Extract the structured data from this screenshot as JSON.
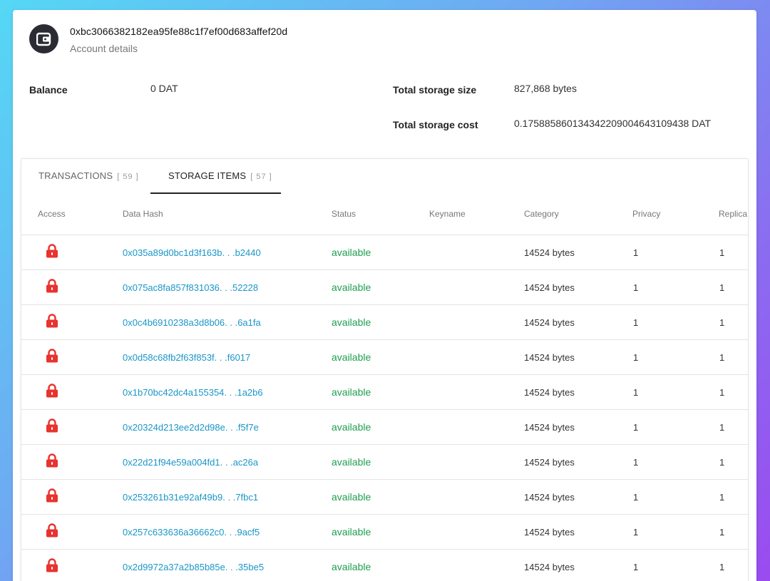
{
  "account": {
    "address": "0xbc3066382182ea95fe88c1f7ef00d683affef20d",
    "subtitle": "Account details",
    "icon": "wallet-icon"
  },
  "summary": {
    "balance_label": "Balance",
    "balance_value": "0 DAT",
    "storage_size_label": "Total storage size",
    "storage_size_value": "827,868 bytes",
    "storage_cost_label": "Total storage cost",
    "storage_cost_value": "0.1758858601343422090046431094 38 DAT"
  },
  "tabs": [
    {
      "label": "TRANSACTIONS",
      "count": "[ 59 ]",
      "active": false
    },
    {
      "label": "STORAGE ITEMS",
      "count": "[ 57 ]",
      "active": true
    }
  ],
  "table": {
    "columns": [
      "Access",
      "Data Hash",
      "Status",
      "Keyname",
      "Category",
      "Privacy",
      "Replica"
    ],
    "rows": [
      {
        "access": "lock-icon",
        "hash": "0x035a89d0bc1d3f163b. . .b2440",
        "status": "available",
        "keyname": "",
        "category": "14524 bytes",
        "privacy": "1",
        "replica": "1"
      },
      {
        "access": "lock-icon",
        "hash": "0x075ac8fa857f831036. . .52228",
        "status": "available",
        "keyname": "",
        "category": "14524 bytes",
        "privacy": "1",
        "replica": "1"
      },
      {
        "access": "lock-icon",
        "hash": "0x0c4b6910238a3d8b06. . .6a1fa",
        "status": "available",
        "keyname": "",
        "category": "14524 bytes",
        "privacy": "1",
        "replica": "1"
      },
      {
        "access": "lock-icon",
        "hash": "0x0d58c68fb2f63f853f. . .f6017",
        "status": "available",
        "keyname": "",
        "category": "14524 bytes",
        "privacy": "1",
        "replica": "1"
      },
      {
        "access": "lock-icon",
        "hash": "0x1b70bc42dc4a155354. . .1a2b6",
        "status": "available",
        "keyname": "",
        "category": "14524 bytes",
        "privacy": "1",
        "replica": "1"
      },
      {
        "access": "lock-icon",
        "hash": "0x20324d213ee2d2d98e. . .f5f7e",
        "status": "available",
        "keyname": "",
        "category": "14524 bytes",
        "privacy": "1",
        "replica": "1"
      },
      {
        "access": "lock-icon",
        "hash": "0x22d21f94e59a004fd1. . .ac26a",
        "status": "available",
        "keyname": "",
        "category": "14524 bytes",
        "privacy": "1",
        "replica": "1"
      },
      {
        "access": "lock-icon",
        "hash": "0x253261b31e92af49b9. . .7fbc1",
        "status": "available",
        "keyname": "",
        "category": "14524 bytes",
        "privacy": "1",
        "replica": "1"
      },
      {
        "access": "lock-icon",
        "hash": "0x257c633636a36662c0. . .9acf5",
        "status": "available",
        "keyname": "",
        "category": "14524 bytes",
        "privacy": "1",
        "replica": "1"
      },
      {
        "access": "lock-icon",
        "hash": "0x2d9972a37a2b85b85e. . .35be5",
        "status": "available",
        "keyname": "",
        "category": "14524 bytes",
        "privacy": "1",
        "replica": "1"
      }
    ]
  },
  "colors": {
    "link": "#1a96c8",
    "status_available": "#1f9e4f",
    "lock": "#e8332e"
  }
}
